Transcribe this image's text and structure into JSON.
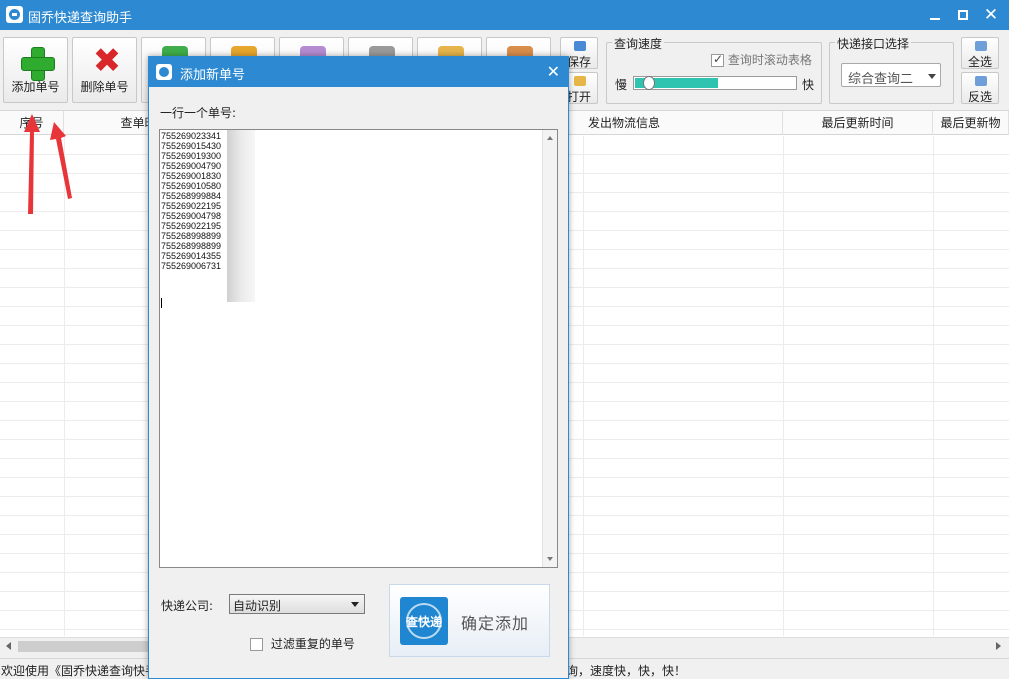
{
  "window": {
    "title": "固乔快递查询助手"
  },
  "toolbar": {
    "add_label": "添加单号",
    "delete_label": "删除单号",
    "save_label": "保存",
    "open_label": "打开",
    "select_all_label": "全选",
    "invert_label": "反选"
  },
  "speed": {
    "group_title": "查询速度",
    "scroll_table_label": "查询时滚动表格",
    "scroll_table_checked": true,
    "slow_label": "慢",
    "fast_label": "快",
    "level": 0.52
  },
  "api": {
    "group_title": "快递接口选择",
    "selected": "综合查询二"
  },
  "table": {
    "columns": [
      "序号",
      "查单时",
      "发出物流信息",
      "最后更新时间",
      "最后更新物"
    ]
  },
  "status": {
    "left": "欢迎使用《固乔快递查询快手",
    "right": "询，速度快，快，快！"
  },
  "dialog": {
    "title": "添加新单号",
    "instruction": "一行一个单号:",
    "numbers": [
      "755269023341",
      "755269015430",
      "755269019300",
      "755269004790",
      "755269001830",
      "755269010580",
      "755268999884",
      "755269022195",
      "755269004798",
      "755269022195",
      "755268998899",
      "755268998899",
      "755269014355",
      "755269006731"
    ],
    "courier_label": "快递公司:",
    "courier_value": "自动识别",
    "filter_label": "过滤重复的单号",
    "filter_checked": false,
    "confirm_logo": "查快递",
    "confirm_label": "确定添加"
  },
  "colors": {
    "titlebar": "#2d8ad2",
    "slider_fill": "#2ec4b0",
    "arrow": "#e8353a"
  }
}
